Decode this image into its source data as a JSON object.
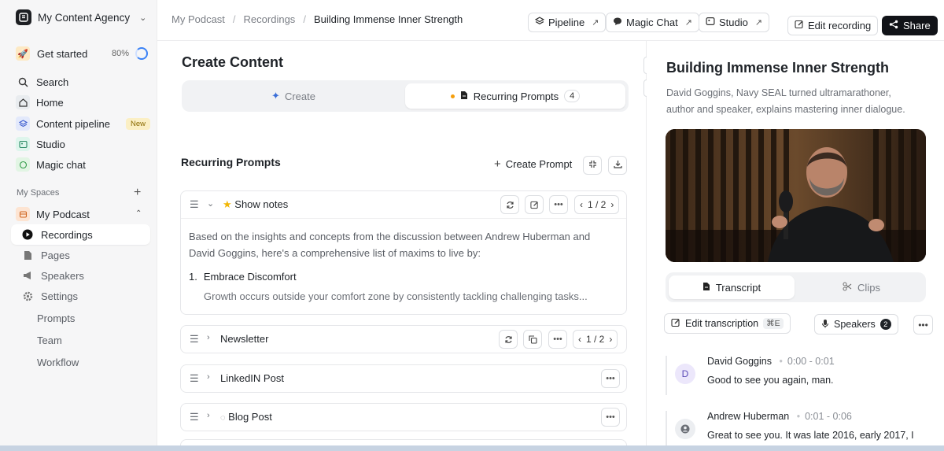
{
  "workspace": {
    "name": "My Content Agency"
  },
  "get_started": {
    "label": "Get started",
    "percent": "80%"
  },
  "nav": {
    "search": "Search",
    "home": "Home",
    "content_pipeline": "Content pipeline",
    "new_badge": "New",
    "studio": "Studio",
    "magic_chat": "Magic chat"
  },
  "spaces": {
    "label": "My Spaces",
    "podcast": "My Podcast",
    "items": [
      "Recordings",
      "Pages",
      "Speakers",
      "Settings"
    ],
    "sub_items": [
      "Prompts",
      "Team",
      "Workflow"
    ]
  },
  "breadcrumb": [
    "My Podcast",
    "Recordings",
    "Building Immense Inner Strength"
  ],
  "toolbar": {
    "pipeline": "Pipeline",
    "magic_chat": "Magic Chat",
    "studio": "Studio",
    "edit_recording": "Edit recording",
    "share": "Share"
  },
  "main": {
    "title": "Create Content",
    "tab_create": "Create",
    "tab_recurring": "Recurring Prompts",
    "recurring_count": "4",
    "section_title": "Recurring Prompts",
    "create_prompt": "Create Prompt",
    "cards": [
      {
        "title": "Show notes",
        "pager": "1 / 2",
        "body": "Based on the insights and concepts from the discussion between Andrew Huberman and David Goggins, here's a comprehensive list of maxims to live by:",
        "list_num": "1.",
        "list_title": "Embrace Discomfort",
        "list_sub": "Growth occurs outside your comfort zone by consistently tackling challenging tasks..."
      },
      {
        "title": "Newsletter",
        "pager": "1 / 2"
      },
      {
        "title": "LinkedIN Post"
      },
      {
        "title": "Blog Post"
      }
    ]
  },
  "panel": {
    "title": "Building Immense Inner Strength",
    "description": "David Goggins, Navy SEAL turned ultramarathoner, author and speaker, explains mastering inner dialogue.",
    "tab_transcript": "Transcript",
    "tab_clips": "Clips",
    "edit_transcription": "Edit transcription",
    "shortcut": "⌘E",
    "speakers": "Speakers",
    "speakers_count": "2",
    "utterances": [
      {
        "initial": "D",
        "speaker": "David Goggins",
        "time": "0:00 - 0:01",
        "text": "Good to see you again, man."
      },
      {
        "speaker": "Andrew Huberman",
        "time": "0:01 - 0:06",
        "text": "Great to see you. It was late 2016, early 2017, I"
      }
    ]
  },
  "colors": {
    "accent": "#3b82f6",
    "share_bg": "#111318",
    "active_dot": "#f59e0b"
  }
}
